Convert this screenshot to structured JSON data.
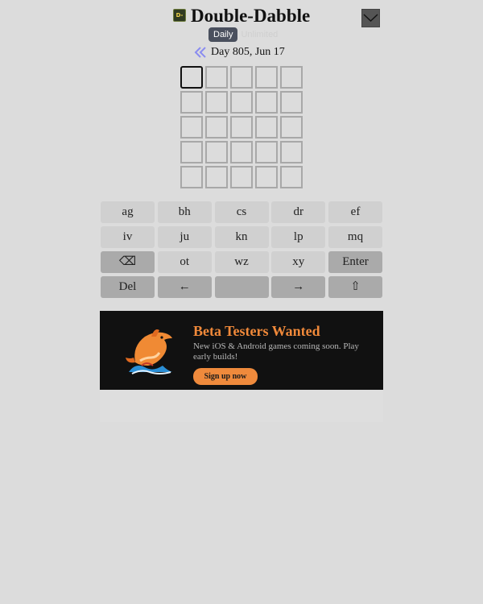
{
  "header": {
    "logo_text": "D-D",
    "title": "Double-Dabble",
    "menu_icon": "chevron-down-icon"
  },
  "mode_tabs": {
    "daily": "Daily",
    "unlimited": "Unlimited"
  },
  "day_nav": {
    "prev_icon": "double-chevron-left-icon",
    "label": "Day 805, Jun 17"
  },
  "board": {
    "rows": 5,
    "cols": 5,
    "active_cell": [
      0,
      0
    ]
  },
  "keyboard": {
    "rows": [
      [
        "ag",
        "bh",
        "cs",
        "dr",
        "ef"
      ],
      [
        "iv",
        "ju",
        "kn",
        "lp",
        "mq"
      ],
      [
        "⌫",
        "ot",
        "wz",
        "xy",
        "Enter"
      ],
      [
        "Del",
        "←",
        "",
        "→",
        "⇧"
      ]
    ]
  },
  "banner": {
    "title": "Beta Testers Wanted",
    "text": "New iOS & Android games coming soon. Play early builds!",
    "button": "Sign up now",
    "image_icon": "dolphin-icon"
  },
  "colors": {
    "background": "#dcdcdc",
    "key": "#d0d0d0",
    "key_dark": "#aaaaaa",
    "banner_bg": "#111111",
    "accent_orange": "#f0893a",
    "nav_purple": "#8a8cf0"
  }
}
